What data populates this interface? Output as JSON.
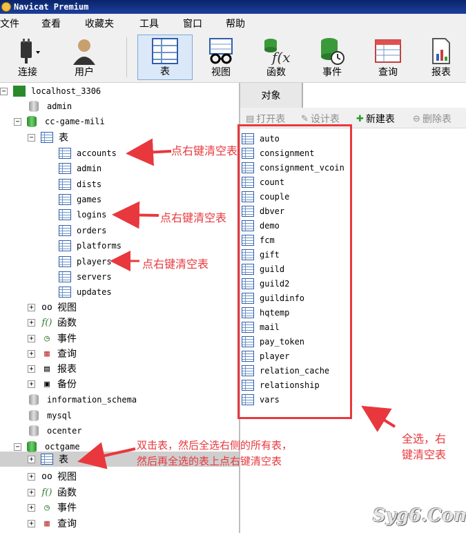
{
  "window": {
    "title": "Navicat Premium"
  },
  "menu": [
    "文件",
    "查看",
    "收藏夹",
    "工具",
    "窗口",
    "帮助"
  ],
  "toolbar": [
    {
      "label": "连接",
      "icon": "plug-icon"
    },
    {
      "label": "用户",
      "icon": "user-icon"
    },
    {
      "label": "表",
      "icon": "table-icon",
      "active": true
    },
    {
      "label": "视图",
      "icon": "glasses-icon"
    },
    {
      "label": "函数",
      "icon": "function-icon"
    },
    {
      "label": "事件",
      "icon": "event-icon"
    },
    {
      "label": "查询",
      "icon": "query-icon"
    },
    {
      "label": "报表",
      "icon": "report-icon"
    }
  ],
  "tree": {
    "connection": "localhost_3306",
    "db_admin": "admin",
    "db_ccgame": "cc-game-mili",
    "tables_label": "表",
    "tables": [
      "accounts",
      "admin",
      "dists",
      "games",
      "logins",
      "orders",
      "platforms",
      "players",
      "servers",
      "updates"
    ],
    "views_label": "视图",
    "functions_label": "函数",
    "events_label": "事件",
    "queries_label": "查询",
    "reports_label": "报表",
    "backups_label": "备份",
    "db_info": "information_schema",
    "db_mysql": "mysql",
    "db_ocenter": "ocenter",
    "db_octgame": "octgame"
  },
  "right": {
    "tab": "对象",
    "buttons": {
      "open": "打开表",
      "design": "设计表",
      "new": "新建表",
      "delete": "删除表"
    },
    "tables": [
      "auto",
      "consignment",
      "consignment_vcoin",
      "count",
      "couple",
      "dbver",
      "demo",
      "fcm",
      "gift",
      "guild",
      "guild2",
      "guildinfo",
      "hqtemp",
      "mail",
      "pay_token",
      "player",
      "relation_cache",
      "relationship",
      "vars"
    ]
  },
  "annotations": {
    "a1": "点右键清空表",
    "a2": "点右键清空表",
    "a3": "点右键清空表",
    "a4_line1": "双击表，然后全选右侧的所有表，",
    "a4_line2": "然后再全选的表上点右键清空表",
    "a5_line1": "全选，右",
    "a5_line2": "键清空表",
    "color": "#e8383d"
  },
  "watermark": "Syg6.Com"
}
